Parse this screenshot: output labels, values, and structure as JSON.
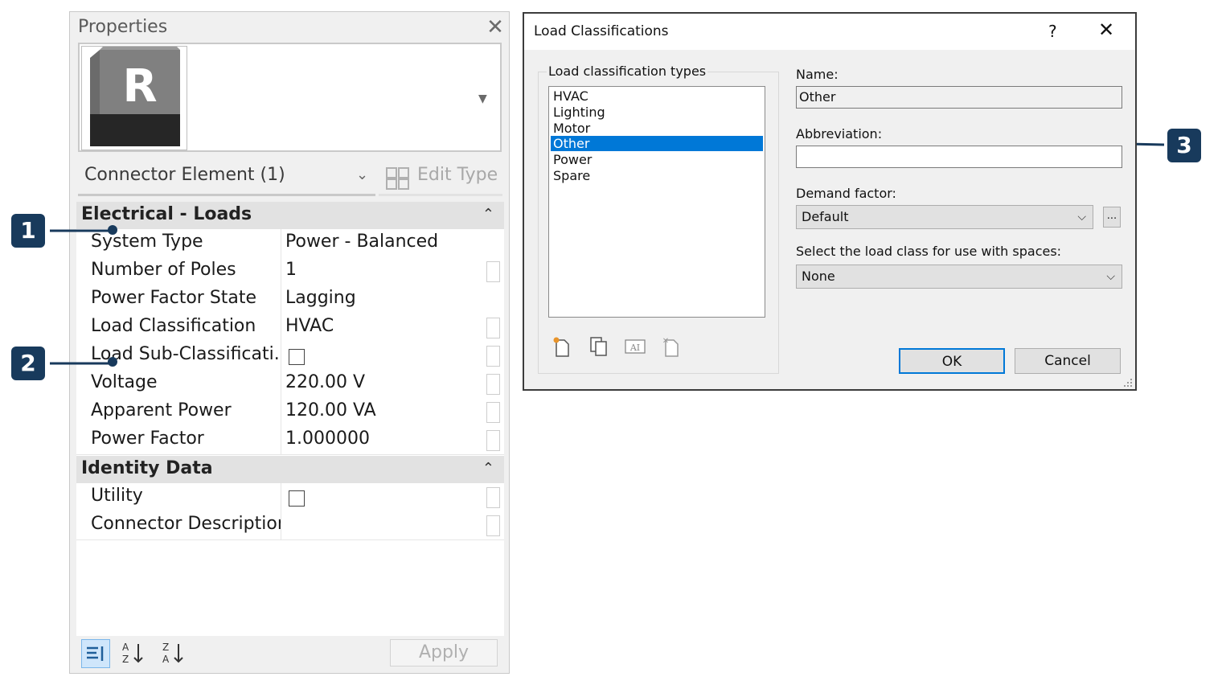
{
  "properties": {
    "title": "Properties",
    "logo_letter": "R",
    "instance_selector": "Connector Element (1)",
    "edit_type_label": "Edit Type",
    "groups": [
      {
        "title": "Electrical - Loads",
        "rows": [
          {
            "name": "System Type",
            "value": "Power - Balanced"
          },
          {
            "name": "Number of Poles",
            "value": "1"
          },
          {
            "name": "Power Factor State",
            "value": "Lagging"
          },
          {
            "name": "Load Classification",
            "value": "HVAC"
          },
          {
            "name": "Load Sub-Classificati...",
            "value": "",
            "checkbox": true
          },
          {
            "name": "Voltage",
            "value": "220.00 V"
          },
          {
            "name": "Apparent Power",
            "value": "120.00 VA"
          },
          {
            "name": "Power Factor",
            "value": "1.000000"
          }
        ]
      },
      {
        "title": "Identity Data",
        "rows": [
          {
            "name": "Utility",
            "value": "",
            "checkbox": true
          },
          {
            "name": "Connector Description",
            "value": ""
          }
        ]
      }
    ],
    "apply_label": "Apply"
  },
  "callouts": [
    "1",
    "2",
    "3"
  ],
  "dialog": {
    "title": "Load Classifications",
    "help": "?",
    "list_label": "Load classification types",
    "list_items": [
      "HVAC",
      "Lighting",
      "Motor",
      "Other",
      "Power",
      "Spare"
    ],
    "selected_item": "Other",
    "name_label": "Name:",
    "name_value": "Other",
    "abbreviation_label": "Abbreviation:",
    "abbreviation_value": "",
    "demand_factor_label": "Demand factor:",
    "demand_factor_value": "Default",
    "ellipsis": "...",
    "spaces_label": "Select the load class for use with spaces:",
    "spaces_value": "None",
    "ok_label": "OK",
    "cancel_label": "Cancel"
  },
  "colors": {
    "callout": "#183a5c",
    "selection": "#0078d7"
  }
}
